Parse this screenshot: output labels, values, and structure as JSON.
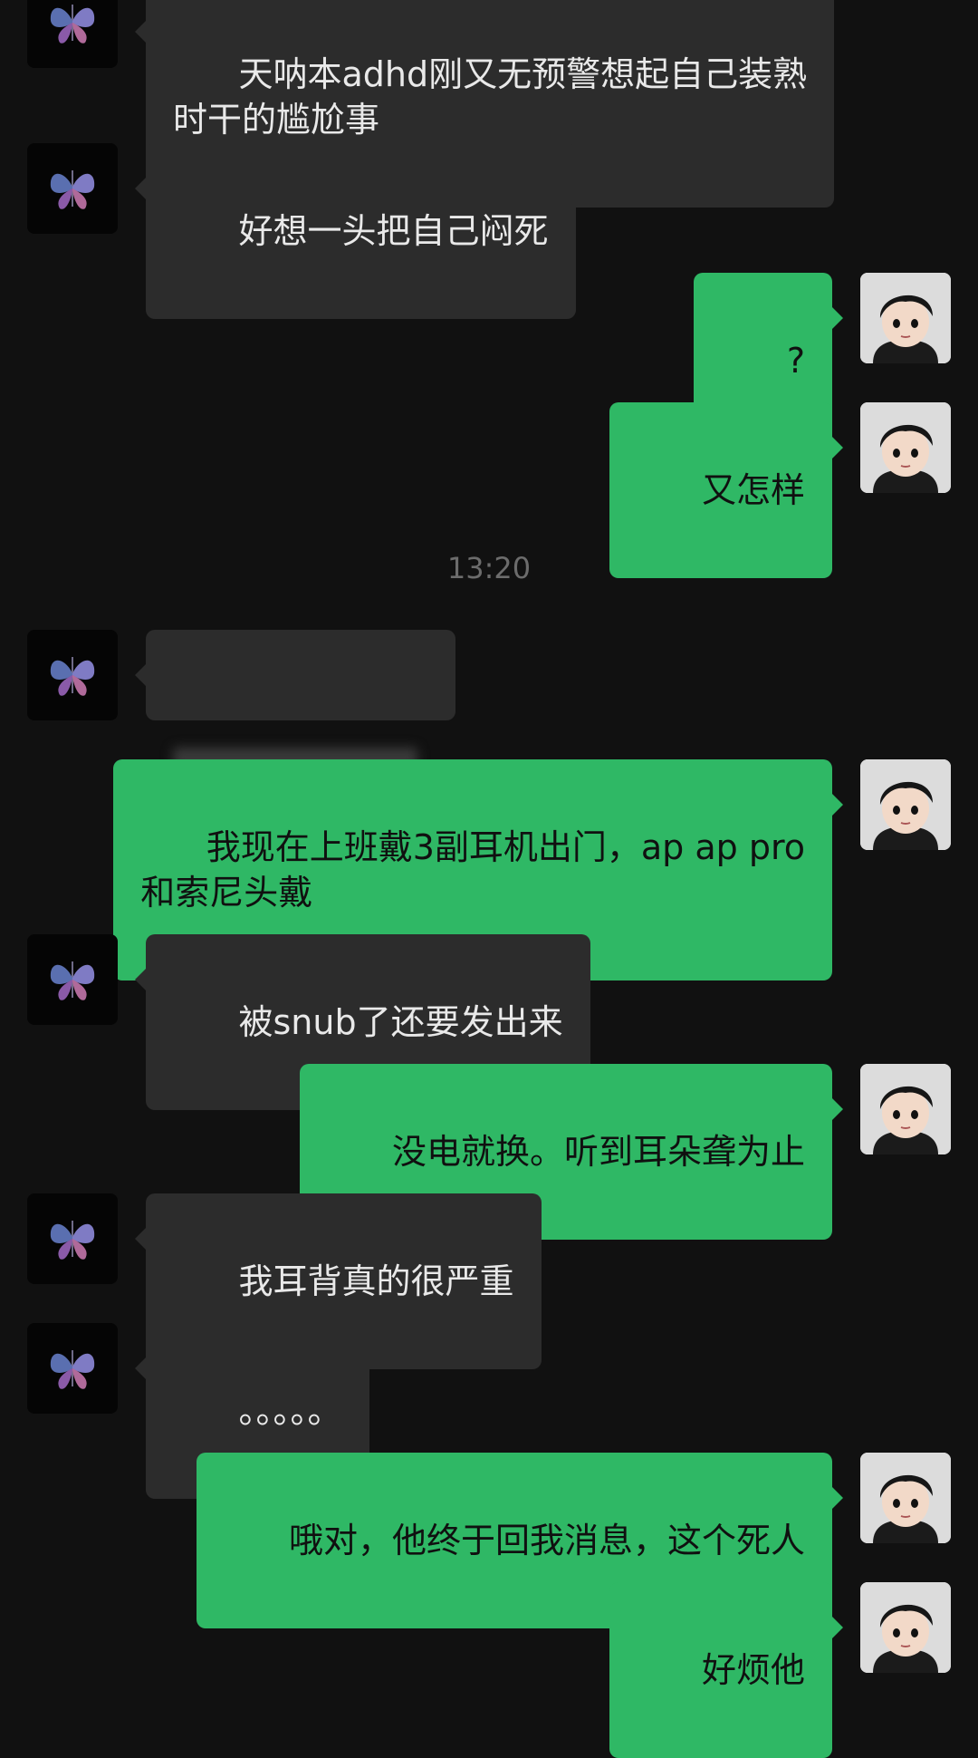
{
  "conversation": {
    "timestamp": "13:20",
    "messages": [
      {
        "side": "left",
        "text": "天呐本adhd刚又无预警想起自己装熟\n时干的尴尬事"
      },
      {
        "side": "left",
        "text": "好想一头把自己闷死"
      },
      {
        "side": "right",
        "text": "?"
      },
      {
        "side": "right",
        "text": "又怎样"
      },
      {
        "side": "left",
        "text": "",
        "blurred": true
      },
      {
        "side": "right",
        "text": "我现在上班戴3副耳机出门，ap ap pro\n和索尼头戴"
      },
      {
        "side": "left",
        "text": "被snub了还要发出来"
      },
      {
        "side": "right",
        "text": "没电就换。听到耳朵聋为止"
      },
      {
        "side": "left",
        "text": "我耳背真的很严重"
      },
      {
        "side": "left",
        "text": "。。。。。"
      },
      {
        "side": "right",
        "text": "哦对，他终于回我消息，这个死人"
      },
      {
        "side": "right",
        "text": "好烦他"
      }
    ]
  },
  "avatars": {
    "left_icon": "butterfly-icon",
    "right_icon": "cartoon-boy-avatar"
  },
  "colors": {
    "background": "#111111",
    "incoming_bubble": "#2c2c2c",
    "outgoing_bubble": "#2fb865",
    "timestamp": "#6c6c6c"
  }
}
